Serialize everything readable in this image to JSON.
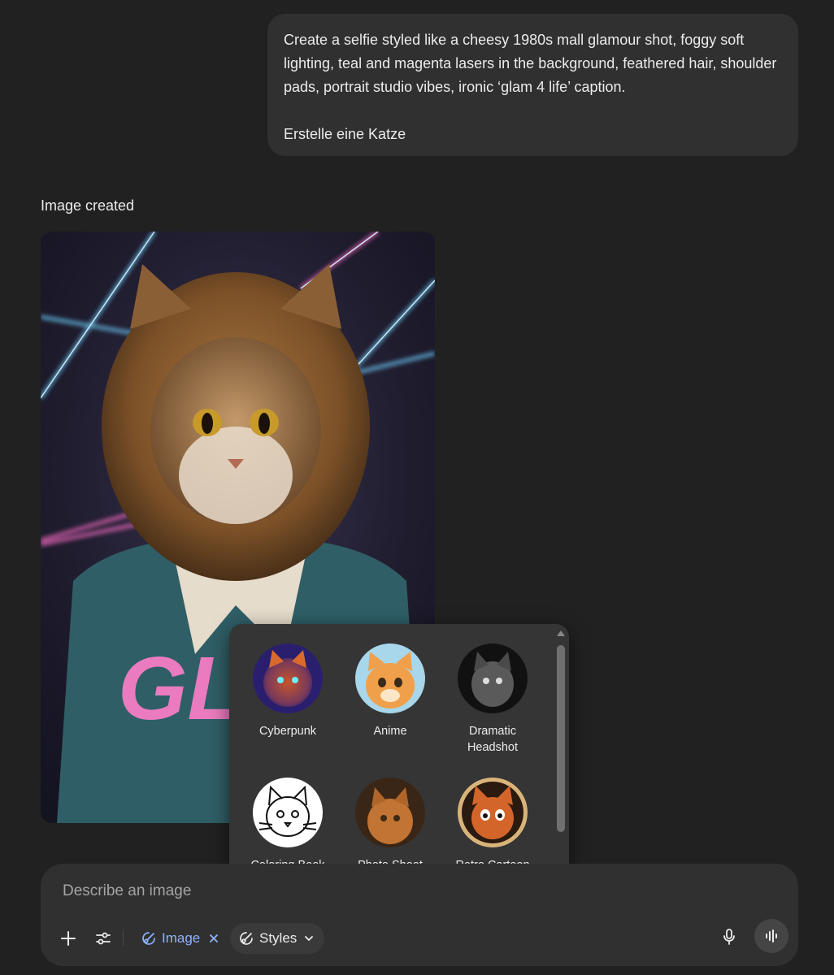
{
  "user_message": {
    "line1": "Create a selfie styled like a cheesy 1980s mall glamour shot, foggy soft lighting, teal and magenta lasers in the background, feathered hair, shoulder pads, portrait studio vibes, ironic ‘glam 4 life’ caption.",
    "line2": "Erstelle eine Katze"
  },
  "response": {
    "status": "Image created",
    "image_caption_visible": "GLA LI"
  },
  "styles_menu": {
    "items": [
      {
        "label": "Cyberpunk",
        "icon": "cyberpunk-cat-thumbnail"
      },
      {
        "label": "Anime",
        "icon": "anime-cat-thumbnail"
      },
      {
        "label": "Dramatic Headshot",
        "icon": "dramatic-headshot-cat-thumbnail"
      },
      {
        "label": "Coloring Book",
        "icon": "coloring-book-cat-thumbnail"
      },
      {
        "label": "Photo Shoot",
        "icon": "photo-shoot-cat-thumbnail"
      },
      {
        "label": "Retro Cartoon",
        "icon": "retro-cartoon-cat-thumbnail"
      }
    ]
  },
  "composer": {
    "placeholder": "Describe an image",
    "image_chip_label": "Image",
    "styles_chip_label": "Styles"
  },
  "colors": {
    "background": "#212121",
    "bubble": "#303030",
    "accent_blue": "#8cb4ff",
    "popup": "#353535"
  }
}
